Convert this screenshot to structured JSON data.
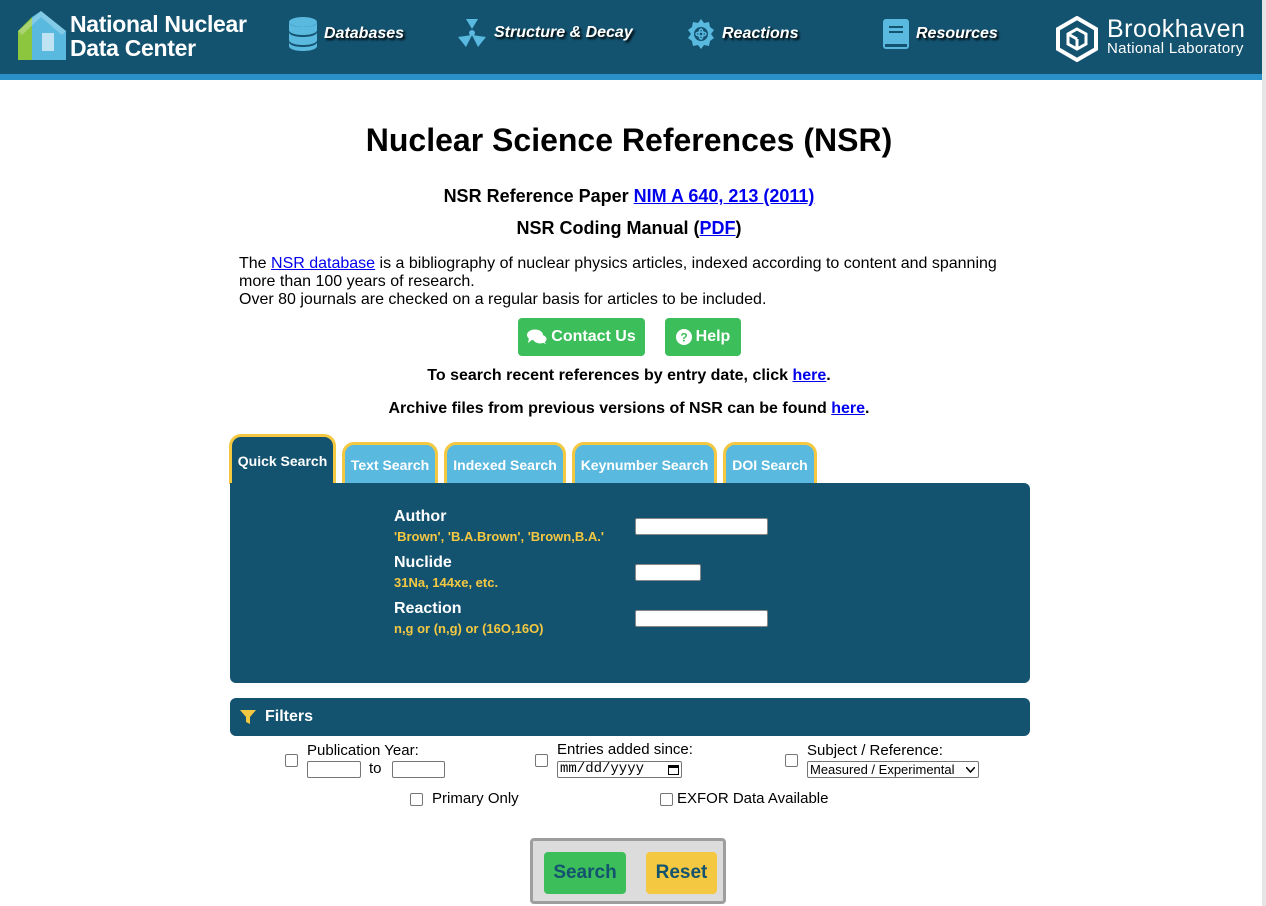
{
  "header": {
    "logo_line1": "National Nuclear",
    "logo_line2": "Data Center",
    "nav": [
      {
        "label": "Databases",
        "icon": "database-icon"
      },
      {
        "label": "Structure & Decay",
        "icon": "radiation-icon"
      },
      {
        "label": "Reactions",
        "icon": "atom-gear-icon"
      },
      {
        "label": "Resources",
        "icon": "book-icon"
      }
    ],
    "bnl_line1": "Brookhaven",
    "bnl_line2": "National Laboratory"
  },
  "page": {
    "title": "Nuclear Science References (NSR)",
    "ref_prefix": "NSR Reference Paper ",
    "ref_link": "NIM A 640, 213 (2011)",
    "manual_prefix": "NSR Coding Manual (",
    "manual_link": "PDF",
    "manual_suffix": ")",
    "desc_the": "The ",
    "desc_link": "NSR database",
    "desc_rest": " is a bibliography of nuclear physics articles, indexed according to content and spanning more than 100 years of research.",
    "desc_line2": "Over 80 journals are checked on a regular basis for articles to be included.",
    "contact_label": "Contact Us",
    "help_label": "Help",
    "recent_prefix": "To search recent references by entry date, click ",
    "recent_link": "here",
    "recent_suffix": ".",
    "archive_prefix": "Archive files from previous versions of NSR can be found ",
    "archive_link": "here",
    "archive_suffix": "."
  },
  "tabs": [
    "Quick Search",
    "Text Search",
    "Indexed Search",
    "Keynumber Search",
    "DOI Search"
  ],
  "active_tab": "Quick Search",
  "quick_search": {
    "author_label": "Author",
    "author_hint": "'Brown', 'B.A.Brown', 'Brown,B.A.'",
    "author_value": "",
    "nuclide_label": "Nuclide",
    "nuclide_hint": "31Na, 144xe, etc.",
    "nuclide_value": "",
    "reaction_label": "Reaction",
    "reaction_hint": "n,g or (n,g) or (16O,16O)",
    "reaction_value": ""
  },
  "filters": {
    "title": "Filters",
    "pub_year_label": "Publication Year:",
    "to_label": "to",
    "entries_label": "Entries added since:",
    "date_placeholder": "mm/dd/yyyy",
    "subject_label": "Subject / Reference:",
    "subject_selected": "Measured / Experimental",
    "primary_only_label": "Primary Only",
    "exfor_label": "EXFOR Data Available"
  },
  "actions": {
    "search_label": "Search",
    "reset_label": "Reset"
  },
  "colors": {
    "header_bg": "#135370",
    "accent_blue": "#2a90c7",
    "tab_inactive": "#5ab9df",
    "tab_border": "#f4c840",
    "green_button": "#3cbe5b",
    "reset_button": "#f4c840"
  }
}
